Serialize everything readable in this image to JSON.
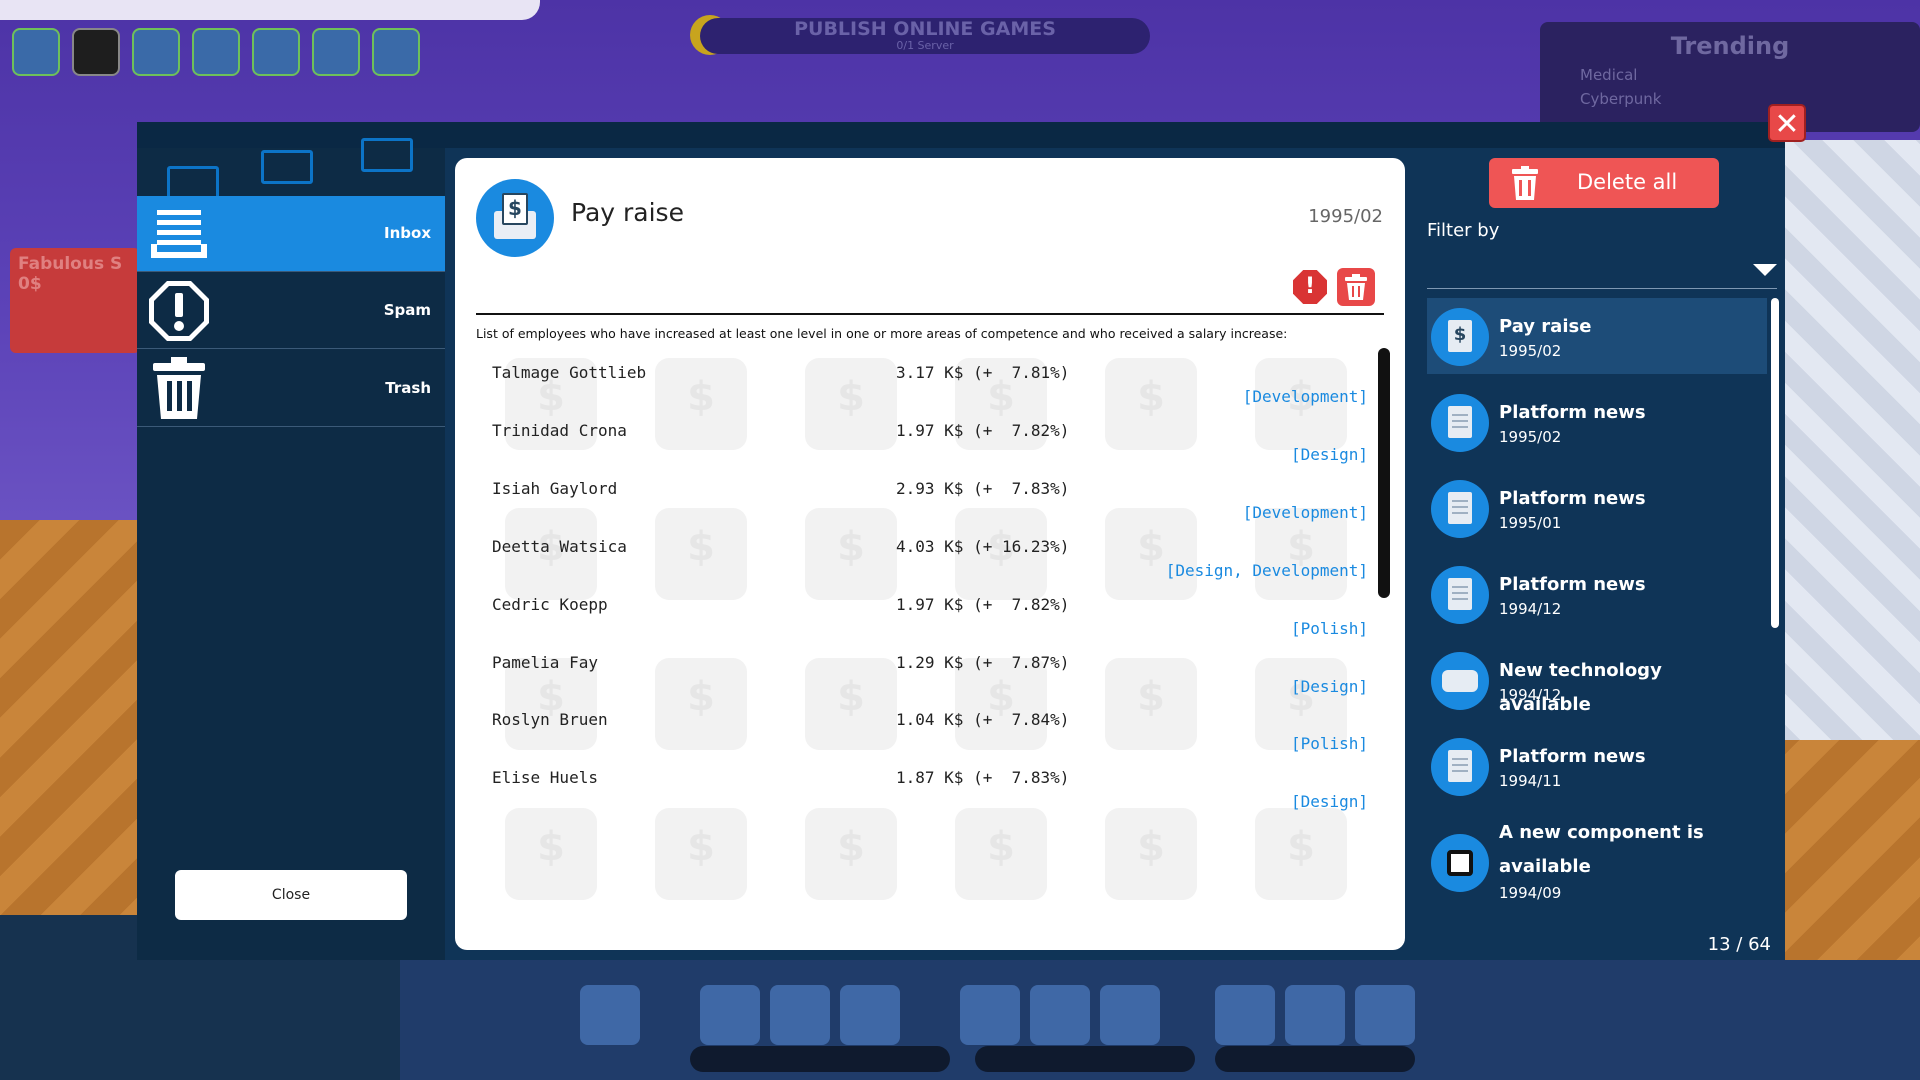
{
  "background": {
    "publish_title": "PUBLISH ONLINE GAMES",
    "publish_sub": "0/1 Server",
    "trending_title": "Trending",
    "trending_items": [
      "Medical",
      "Cyberpunk"
    ],
    "studio_name": "Fabulous S",
    "studio_money": "0$"
  },
  "sidebar": {
    "items": [
      {
        "label": "Inbox",
        "icon": "inbox-tray-icon"
      },
      {
        "label": "Spam",
        "icon": "exclamation-icon"
      },
      {
        "label": "Trash",
        "icon": "trash-icon"
      }
    ],
    "close_label": "Close"
  },
  "message": {
    "title": "Pay raise",
    "date": "1995/02",
    "intro": "List of employees who have increased at least one level in one or more areas of competence and who received a salary increase:",
    "rows": [
      {
        "name": "Talmage Gottlieb",
        "salary": "3.17 K$ (+  7.81%)",
        "skills": "[Development]"
      },
      {
        "name": "Trinidad Crona",
        "salary": "1.97 K$ (+  7.82%)",
        "skills": "[Design]"
      },
      {
        "name": "Isiah Gaylord",
        "salary": "2.93 K$ (+  7.83%)",
        "skills": "[Development]"
      },
      {
        "name": "Deetta Watsica",
        "salary": "4.03 K$ (+ 16.23%)",
        "skills": "[Design, Development]"
      },
      {
        "name": "Cedric Koepp",
        "salary": "1.97 K$ (+  7.82%)",
        "skills": "[Polish]"
      },
      {
        "name": "Pamelia Fay",
        "salary": "1.29 K$ (+  7.87%)",
        "skills": "[Design]"
      },
      {
        "name": "Roslyn Bruen",
        "salary": "1.04 K$ (+  7.84%)",
        "skills": "[Polish]"
      },
      {
        "name": "Elise Huels",
        "salary": "1.87 K$ (+  7.83%)",
        "skills": "[Design]"
      }
    ]
  },
  "right": {
    "delete_all_label": "Delete all",
    "filter_label": "Filter by",
    "messages": [
      {
        "title": "Pay raise",
        "date": "1995/02",
        "icon": "money-letter-icon"
      },
      {
        "title": "Platform news",
        "date": "1995/02",
        "icon": "news-paper-icon"
      },
      {
        "title": "Platform news",
        "date": "1995/01",
        "icon": "news-paper-icon"
      },
      {
        "title": "Platform news",
        "date": "1994/12",
        "icon": "news-paper-icon"
      },
      {
        "title": "New technology available",
        "date": "1994/12",
        "icon": "gamepad-icon"
      },
      {
        "title": "Platform news",
        "date": "1994/11",
        "icon": "news-paper-icon"
      },
      {
        "title": "A new component is available",
        "date": "1994/09",
        "icon": "chip-icon"
      }
    ],
    "counter": "13 / 64"
  },
  "colors": {
    "accent": "#1a8ae0",
    "panel": "#0f3457",
    "danger": "#e84848"
  }
}
